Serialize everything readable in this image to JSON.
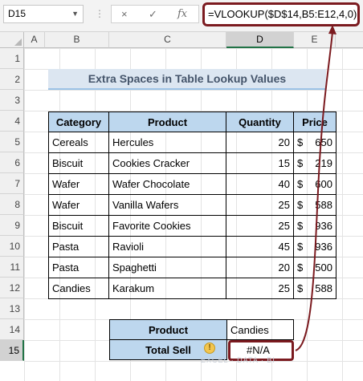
{
  "formula_bar": {
    "name_box": "D15",
    "cancel_icon": "×",
    "enter_icon": "✓",
    "fx_label": "fx",
    "formula": "=VLOOKUP($D$14,B5:E12,4,0)"
  },
  "columns": [
    "A",
    "B",
    "C",
    "D",
    "E"
  ],
  "rows": [
    "1",
    "2",
    "3",
    "4",
    "5",
    "6",
    "7",
    "8",
    "9",
    "10",
    "11",
    "12",
    "13",
    "14",
    "15"
  ],
  "sheet": {
    "title": "Extra Spaces in Table Lookup Values",
    "table": {
      "headers": [
        "Category",
        "Product",
        "Quantity",
        "Price"
      ],
      "rows": [
        {
          "category": "Cereals",
          "product": "Hercules",
          "quantity": "20",
          "currency": "$",
          "price": "650"
        },
        {
          "category": "Biscuit",
          "product": "Cookies Cracker",
          "quantity": "15",
          "currency": "$",
          "price": "219"
        },
        {
          "category": "Wafer",
          "product": "Wafer Chocolate",
          "quantity": "40",
          "currency": "$",
          "price": "600"
        },
        {
          "category": "Wafer",
          "product": "Vanilla Wafers",
          "quantity": "25",
          "currency": "$",
          "price": "588"
        },
        {
          "category": "Biscuit",
          "product": "Favorite Cookies",
          "quantity": "25",
          "currency": "$",
          "price": "936"
        },
        {
          "category": "Pasta",
          "product": "Ravioli",
          "quantity": "45",
          "currency": "$",
          "price": "936"
        },
        {
          "category": "Pasta",
          "product": "Spaghetti",
          "quantity": "20",
          "currency": "$",
          "price": "500"
        },
        {
          "category": "Candies",
          "product": "Karakum",
          "quantity": "25",
          "currency": "$",
          "price": "588"
        }
      ]
    },
    "lookup": {
      "product_label": "Product",
      "product_value": "Candies",
      "total_label": "Total Sell",
      "total_value": "#N/A"
    },
    "watermark": "EXCEL · DATA · BI"
  },
  "colors": {
    "accent_border": "#7b1a1f",
    "header_fill": "#bdd7ee",
    "title_fill": "#dce6f1"
  }
}
